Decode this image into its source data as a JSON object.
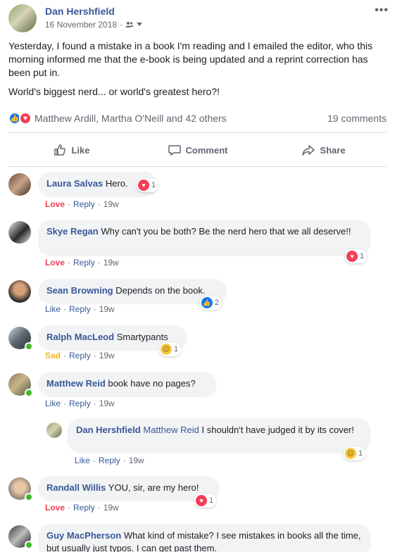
{
  "post": {
    "author": "Dan Hershfield",
    "date": "16 November 2018",
    "audience_icon": "friends-icon",
    "more": "•••",
    "body": [
      "Yesterday, I found a mistake in a book I'm reading and I emailed the editor, who this morning informed me that the e-book is being updated and a reprint correction has been put in.",
      "World's biggest nerd... or world's greatest hero?!"
    ],
    "reactions_text": "Matthew Ardill, Martha O'Neill and 42 others",
    "comments_count": "19 comments"
  },
  "actions": {
    "like": "Like",
    "comment": "Comment",
    "share": "Share"
  },
  "comments": [
    {
      "name": "Laura Salvas",
      "text": "Hero.",
      "reaction_label": "Love",
      "reply": "Reply",
      "time": "19w",
      "count": "1",
      "reaction": "love"
    },
    {
      "name": "Skye Regan",
      "text": "Why can't you be both? Be the nerd hero that we all deserve!!",
      "reaction_label": "Love",
      "reply": "Reply",
      "time": "19w",
      "count": "1",
      "reaction": "love"
    },
    {
      "name": "Sean Browning",
      "text": "Depends on the book.",
      "reaction_label": "Like",
      "reply": "Reply",
      "time": "19w",
      "count": "2",
      "reaction": "like"
    },
    {
      "name": "Ralph MacLeod",
      "text": "Smartypants",
      "reaction_label": "Sad",
      "reply": "Reply",
      "time": "19w",
      "count": "1",
      "reaction": "sad"
    },
    {
      "name": "Matthew Reid",
      "text": "book have no pages?",
      "reaction_label": "Like",
      "reply": "Reply",
      "time": "19w"
    },
    {
      "name": "Dan Hershfield",
      "mention": "Matthew Reid",
      "text": "I shouldn't have judged it by its cover!",
      "reaction_label": "Like",
      "reply": "Reply",
      "time": "19w",
      "count": "1",
      "reaction": "sad"
    },
    {
      "name": "Randall Willis",
      "text": "YOU, sir, are my hero!",
      "reaction_label": "Love",
      "reply": "Reply",
      "time": "19w",
      "count": "1",
      "reaction": "love"
    },
    {
      "name": "Guy MacPherson",
      "text": "What kind of mistake? I see mistakes in books all the time, but usually just typos. I can get past them."
    }
  ],
  "colors": {
    "link": "#385898",
    "love": "#f33e58",
    "like": "#1877f2",
    "sad": "#f7b125",
    "online": "#42b72a"
  }
}
